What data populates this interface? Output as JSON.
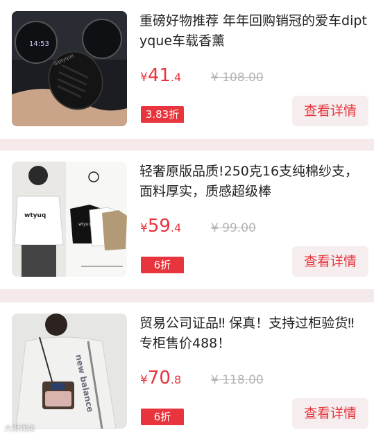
{
  "products": [
    {
      "title": "重磅好物推荐 年年回购销冠的爱车diptyque车载香薰",
      "price_currency": "¥",
      "price_int": "41",
      "price_dec": ".4",
      "original_price": "¥ 108.00",
      "discount": "3.83折",
      "button_label": "查看详情",
      "image_label": "diptyque"
    },
    {
      "title": "轻奢原版品质!250克16支纯棉纱支，面料厚实，质感超级棒",
      "price_currency": "¥",
      "price_int": "59",
      "price_dec": ".4",
      "original_price": "¥ 99.00",
      "discount": "6折",
      "button_label": "查看详情",
      "image_label": "wtyuq"
    },
    {
      "title": "贸易公司证品‼ 保真！支持过柜验货‼ 专柜售价488！",
      "price_currency": "¥",
      "price_int": "70",
      "price_dec": ".8",
      "original_price": "¥ 118.00",
      "discount": "6折",
      "button_label": "查看详情",
      "image_label": "new balance"
    }
  ],
  "watermark": "大眼视频",
  "colors": {
    "accent": "#e8343c",
    "background": "#f5e9ea",
    "button_bg": "#f6eeee"
  }
}
